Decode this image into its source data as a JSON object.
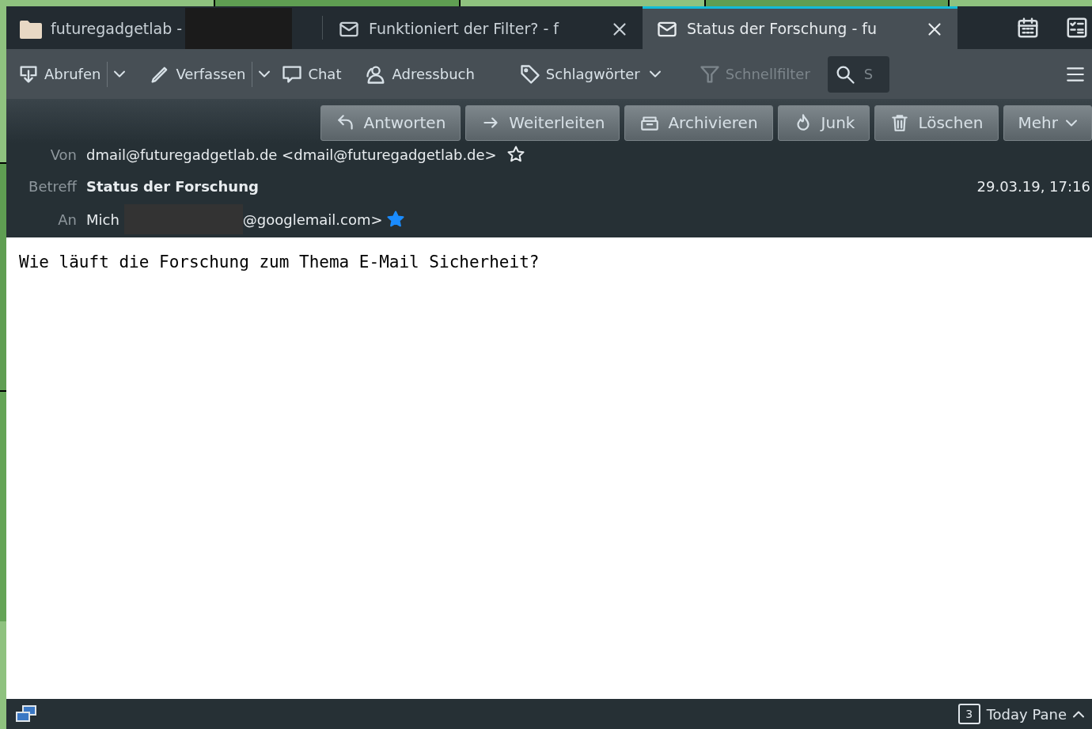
{
  "tabs": [
    {
      "kind": "folder",
      "label": "futuregadgetlab -",
      "selected": false
    },
    {
      "kind": "message",
      "label": "Funktioniert der Filter? - f",
      "selected": false
    },
    {
      "kind": "message",
      "label": "Status der Forschung - fu",
      "selected": true
    }
  ],
  "toolbar": {
    "items": [
      {
        "kind": "split",
        "label": "Abrufen",
        "disabled": false
      },
      {
        "kind": "split",
        "label": "Verfassen",
        "disabled": false
      },
      {
        "kind": "plain",
        "label": "Chat",
        "disabled": false
      },
      {
        "kind": "plain",
        "label": "Adressbuch",
        "disabled": false
      },
      {
        "kind": "dropdown",
        "label": "Schlagwörter",
        "disabled": false
      },
      {
        "kind": "plain",
        "label": "Schnellfilter",
        "disabled": true
      }
    ],
    "search": {
      "placeholder": "S"
    }
  },
  "message_actions": [
    {
      "kind": "plain",
      "label": "Antworten"
    },
    {
      "kind": "plain",
      "label": "Weiterleiten"
    },
    {
      "kind": "plain",
      "label": "Archivieren"
    },
    {
      "kind": "plain",
      "label": "Junk"
    },
    {
      "kind": "plain",
      "label": "Löschen"
    },
    {
      "kind": "dropdown",
      "label": "Mehr"
    }
  ],
  "header": {
    "from": {
      "label": "Von",
      "value": "dmail@futuregadgetlab.de <dmail@futuregadgetlab.de>",
      "starred": false
    },
    "subject": {
      "label": "Betreff",
      "value": "Status der Forschung"
    },
    "date": "29.03.19, 17:16",
    "to": {
      "label": "An",
      "name": "Mich",
      "address": "@googlemail.com>",
      "starred": true
    }
  },
  "body": "Wie läuft die Forschung zum Thema E-Mail Sicherheit?",
  "status_bar": {
    "today_day": "3",
    "today_pane": "Today Pane"
  }
}
